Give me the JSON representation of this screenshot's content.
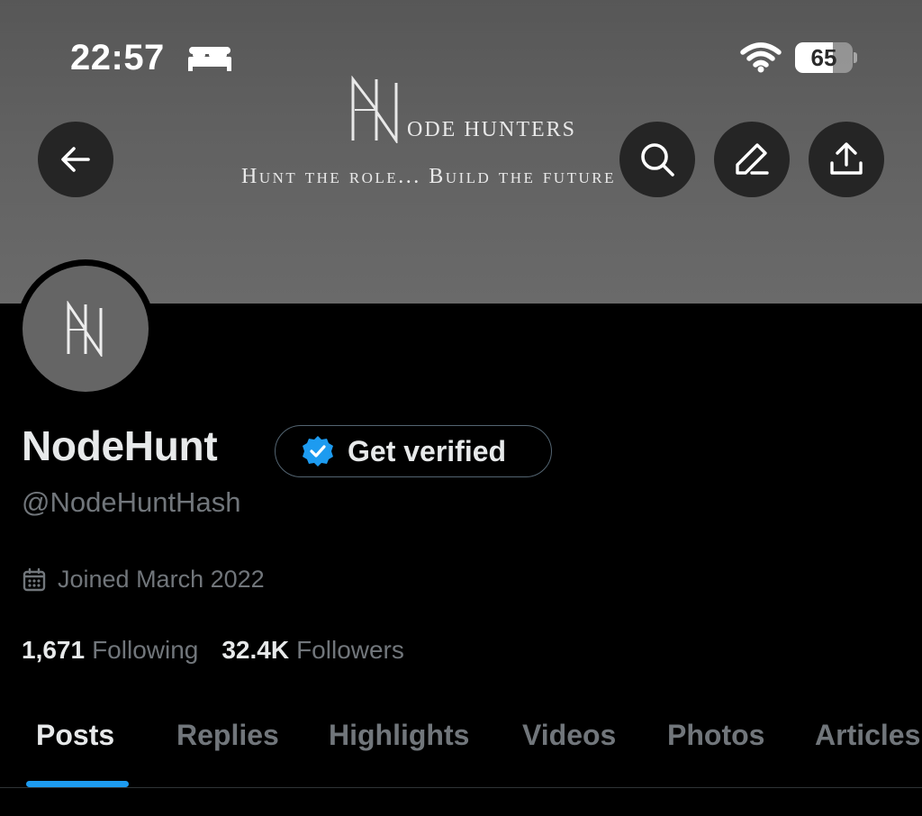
{
  "status_bar": {
    "time": "22:57",
    "focus_icon": "bed-icon",
    "wifi_icon": "wifi-icon",
    "battery_level": "65",
    "battery_fraction": 0.65
  },
  "banner": {
    "brand_name": "ODE HUNTERS",
    "tagline": "Hunt the role... Build the future"
  },
  "header_buttons": {
    "back_icon": "arrow-left-icon",
    "search_icon": "search-icon",
    "edit_icon": "pencil-icon",
    "share_icon": "share-icon"
  },
  "profile": {
    "display_name": "NodeHunt",
    "handle": "@NodeHuntHash",
    "verify_label": "Get verified",
    "joined": "Joined March 2022",
    "following_count": "1,671",
    "following_label": "Following",
    "followers_count": "32.4K",
    "followers_label": "Followers"
  },
  "tabs": [
    {
      "label": "Posts",
      "active": true
    },
    {
      "label": "Replies",
      "active": false
    },
    {
      "label": "Highlights",
      "active": false
    },
    {
      "label": "Videos",
      "active": false
    },
    {
      "label": "Photos",
      "active": false
    },
    {
      "label": "Articles",
      "active": false
    }
  ],
  "colors": {
    "accent": "#1d9bf0",
    "background": "#000000",
    "banner": "#616161",
    "secondary_text": "#71767b"
  }
}
